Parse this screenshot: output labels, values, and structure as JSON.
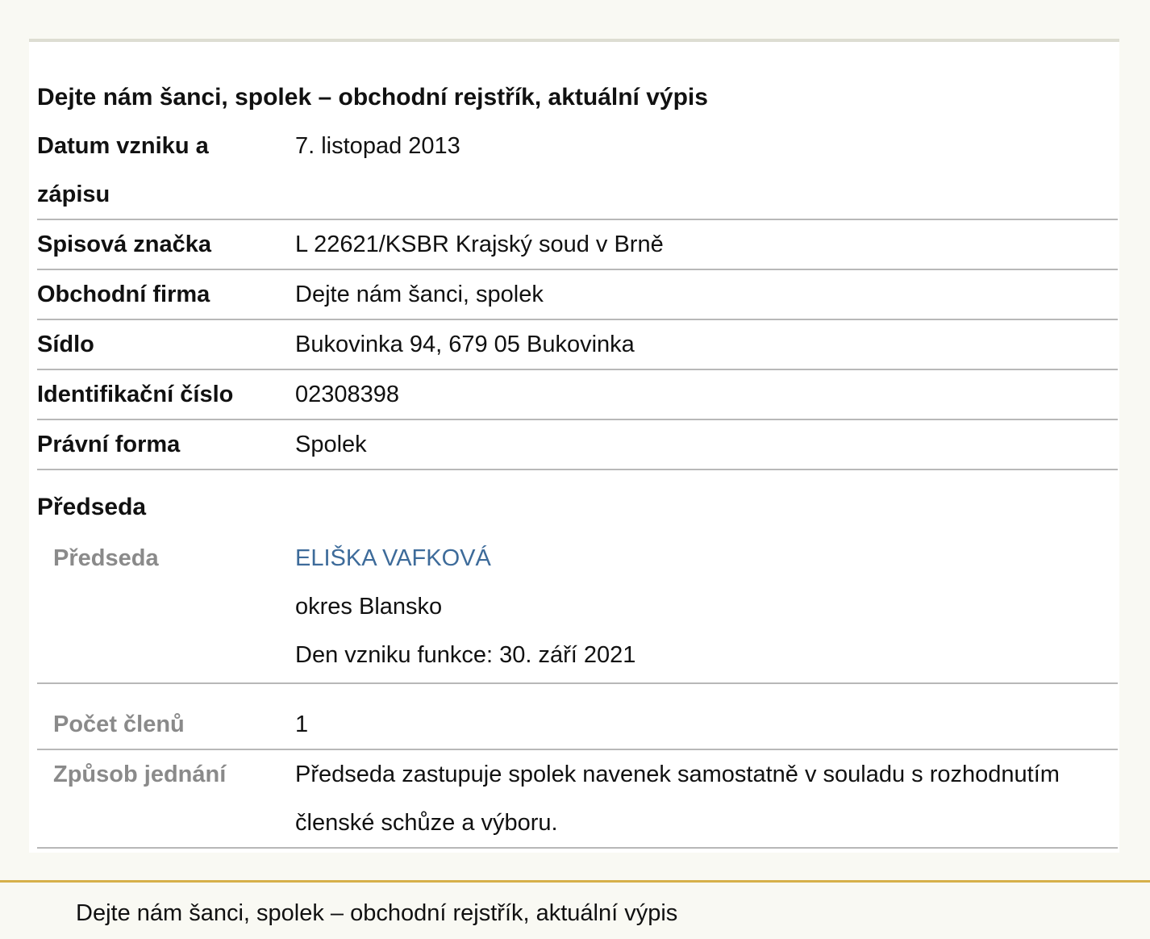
{
  "title": "Dejte nám šanci, spolek – obchodní rejstřík, aktuální výpis",
  "rows": [
    {
      "label": "Datum vzniku a zápisu",
      "value": "7. listopad 2013"
    },
    {
      "label": "Spisová značka",
      "value": "L 22621/KSBR Krajský soud v Brně"
    },
    {
      "label": "Obchodní firma",
      "value": "Dejte nám šanci, spolek"
    },
    {
      "label": "Sídlo",
      "value": "Bukovinka 94, 679 05 Bukovinka"
    },
    {
      "label": "Identifikační číslo",
      "value": "02308398"
    },
    {
      "label": "Právní forma",
      "value": "Spolek"
    }
  ],
  "section_title": "Předseda",
  "chair": {
    "label": "Předseda",
    "name": "ELIŠKA VAFKOVÁ",
    "district": "okres Blansko",
    "since": "Den vzniku funkce: 30. září 2021"
  },
  "members": {
    "label": "Počet členů",
    "value": "1"
  },
  "representation": {
    "label": "Způsob jednání",
    "value": "Předseda zastupuje spolek navenek samostatně v souladu s rozhodnutím členské schůze a výboru."
  },
  "footer_text": "Dejte nám šanci, spolek – obchodní rejstřík, aktuální výpis",
  "colors": {
    "link": "#3d6b9a",
    "footer_border": "#d6b04a"
  }
}
